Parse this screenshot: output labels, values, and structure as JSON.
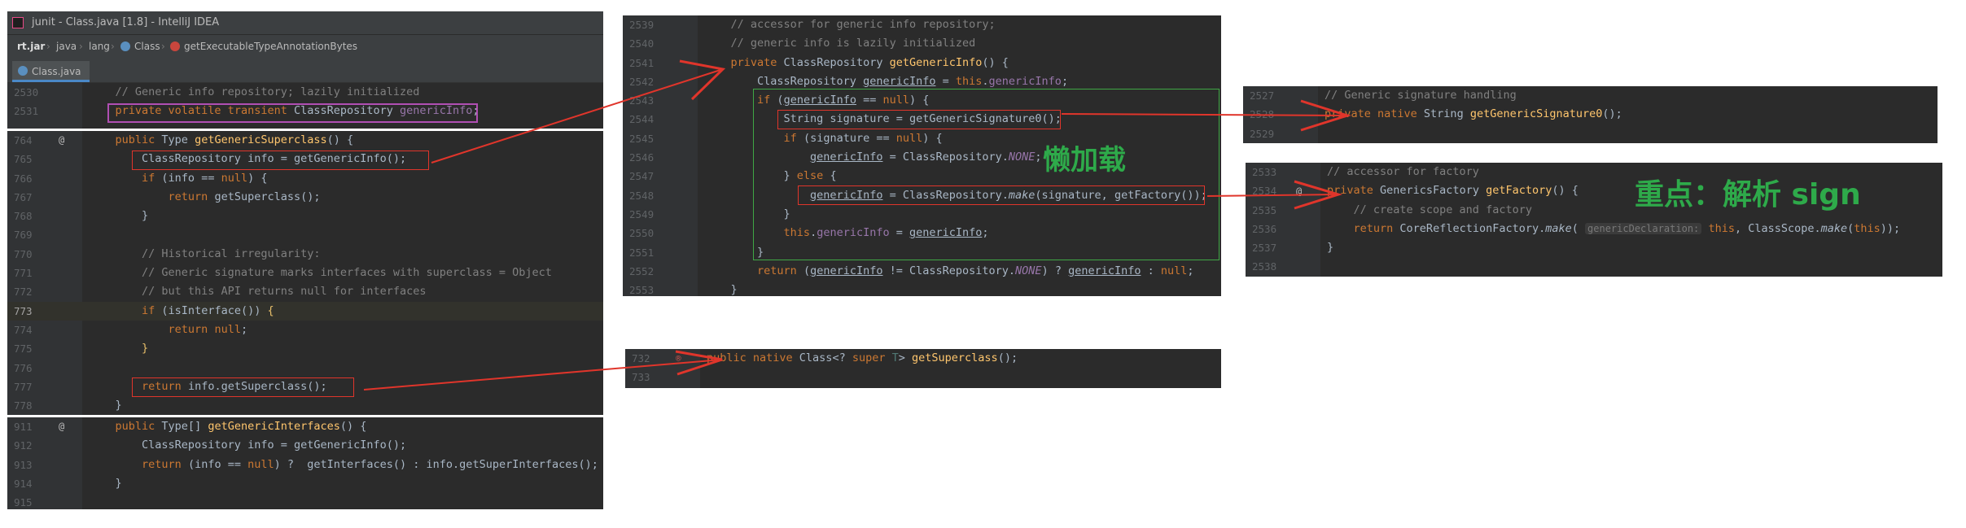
{
  "window": {
    "title": "junit - Class.java [1.8] - IntelliJ IDEA"
  },
  "breadcrumb": [
    "rt.jar",
    "java",
    "lang",
    "Class",
    "getExecutableTypeAnnotationBytes"
  ],
  "tab": {
    "label": "Class.java"
  },
  "panel1": {
    "lines": [
      {
        "n": "2530",
        "t": "    // Generic info repository; lazily initialized"
      },
      {
        "n": "2531",
        "t": "    private volatile transient ClassRepository genericInfo;"
      }
    ]
  },
  "panel2": {
    "lines": [
      {
        "n": "764",
        "t": "    public Type getGenericSuperclass() {"
      },
      {
        "n": "765",
        "t": "        ClassRepository info = getGenericInfo();"
      },
      {
        "n": "766",
        "t": "        if (info == null) {"
      },
      {
        "n": "767",
        "t": "            return getSuperclass();"
      },
      {
        "n": "768",
        "t": "        }"
      },
      {
        "n": "769",
        "t": ""
      },
      {
        "n": "770",
        "t": "        // Historical irregularity:"
      },
      {
        "n": "771",
        "t": "        // Generic signature marks interfaces with superclass = Object"
      },
      {
        "n": "772",
        "t": "        // but this API returns null for interfaces"
      },
      {
        "n": "773",
        "t": "        if (isInterface()) {"
      },
      {
        "n": "774",
        "t": "            return null;"
      },
      {
        "n": "775",
        "t": "        }"
      },
      {
        "n": "776",
        "t": ""
      },
      {
        "n": "777",
        "t": "        return info.getSuperclass();"
      },
      {
        "n": "778",
        "t": "    }"
      }
    ]
  },
  "panel3": {
    "lines": [
      {
        "n": "911",
        "t": "    public Type[] getGenericInterfaces() {"
      },
      {
        "n": "912",
        "t": "        ClassRepository info = getGenericInfo();"
      },
      {
        "n": "913",
        "t": "        return (info == null) ?  getInterfaces() : info.getSuperInterfaces();"
      },
      {
        "n": "914",
        "t": "    }"
      },
      {
        "n": "915",
        "t": ""
      }
    ]
  },
  "panel4": {
    "lines": [
      {
        "n": "2539",
        "t": "    // accessor for generic info repository;"
      },
      {
        "n": "2540",
        "t": "    // generic info is lazily initialized"
      },
      {
        "n": "2541",
        "t": "    private ClassRepository getGenericInfo() {"
      },
      {
        "n": "2542",
        "t": "        ClassRepository genericInfo = this.genericInfo;"
      },
      {
        "n": "2543",
        "t": "        if (genericInfo == null) {"
      },
      {
        "n": "2544",
        "t": "            String signature = getGenericSignature0();"
      },
      {
        "n": "2545",
        "t": "            if (signature == null) {"
      },
      {
        "n": "2546",
        "t": "                genericInfo = ClassRepository.NONE;"
      },
      {
        "n": "2547",
        "t": "            } else {"
      },
      {
        "n": "2548",
        "t": "                genericInfo = ClassRepository.make(signature, getFactory());"
      },
      {
        "n": "2549",
        "t": "            }"
      },
      {
        "n": "2550",
        "t": "            this.genericInfo = genericInfo;"
      },
      {
        "n": "2551",
        "t": "        }"
      },
      {
        "n": "2552",
        "t": "        return (genericInfo != ClassRepository.NONE) ? genericInfo : null;"
      },
      {
        "n": "2553",
        "t": "    }"
      }
    ]
  },
  "panel5": {
    "lines": [
      {
        "n": "732",
        "t": "    public native Class<? super T> getSuperclass();"
      },
      {
        "n": "733",
        "t": ""
      }
    ]
  },
  "panel6": {
    "lines": [
      {
        "n": "2527",
        "t": "    // Generic signature handling"
      },
      {
        "n": "2528",
        "t": "    private native String getGenericSignature0();"
      },
      {
        "n": "2529",
        "t": ""
      }
    ]
  },
  "panel7": {
    "lines": [
      {
        "n": "2533",
        "t": "    // accessor for factory"
      },
      {
        "n": "2534",
        "t": "    private GenericsFactory getFactory() {"
      },
      {
        "n": "2535",
        "t": "        // create scope and factory"
      },
      {
        "n": "2536",
        "t": "        return CoreReflectionFactory.make( genericDeclaration: this, ClassScope.make(this));"
      },
      {
        "n": "2537",
        "t": "    }"
      },
      {
        "n": "2538",
        "t": ""
      }
    ]
  },
  "annotations": {
    "lazy_load": "懒加载",
    "key_point": "重点：解析 sign"
  },
  "colors": {
    "arrow": "#e0352b",
    "annotation": "#2eaa4a",
    "editor_bg": "#2b2b2b"
  }
}
